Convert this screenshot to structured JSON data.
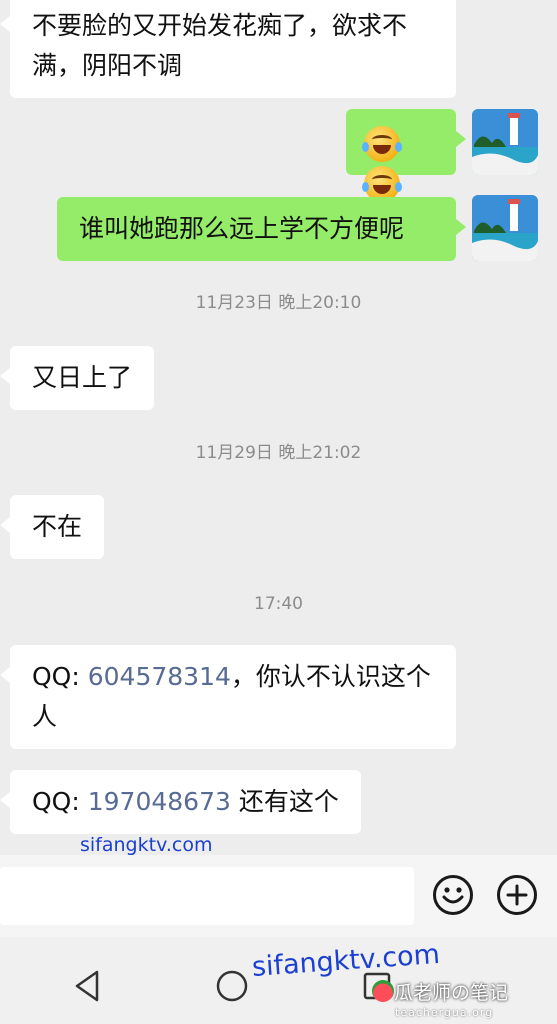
{
  "messages": [
    {
      "type": "in",
      "text": "不要脸的又开始发花痴了，欲求不满，阴阳不调"
    },
    {
      "type": "out",
      "emoji": [
        "laugh-cry-emoji",
        "laugh-cry-emoji"
      ]
    },
    {
      "type": "out",
      "text": "谁叫她跑那么远上学不方便呢"
    },
    {
      "type": "time",
      "text": "11月23日 晚上20:10"
    },
    {
      "type": "in",
      "text": "又日上了"
    },
    {
      "type": "time",
      "text": "11月29日 晚上21:02"
    },
    {
      "type": "in",
      "text": "不在"
    },
    {
      "type": "time",
      "text": "17:40"
    },
    {
      "type": "in",
      "prefix": "QQ: ",
      "qq": "604578314",
      "suffix": "，你认不认识这个人"
    },
    {
      "type": "in",
      "prefix": "QQ: ",
      "qq": "197048673",
      "suffix": " 还有这个"
    }
  ],
  "input": {
    "value": ""
  },
  "icons": {
    "emoji_button": "smiley-icon",
    "plus_button": "plus-icon",
    "back": "back-triangle-icon",
    "home": "home-circle-icon",
    "recent": "recent-square-icon"
  },
  "watermarks": {
    "top": "sifangktv.com",
    "bottom": "sifangktv.com",
    "brand": "瓜老师の笔记",
    "brand_url": "teachergua.org"
  },
  "colors": {
    "outgoing_bubble": "#95ec69",
    "incoming_bubble": "#ffffff",
    "link": "#576b95",
    "background": "#ededed"
  }
}
